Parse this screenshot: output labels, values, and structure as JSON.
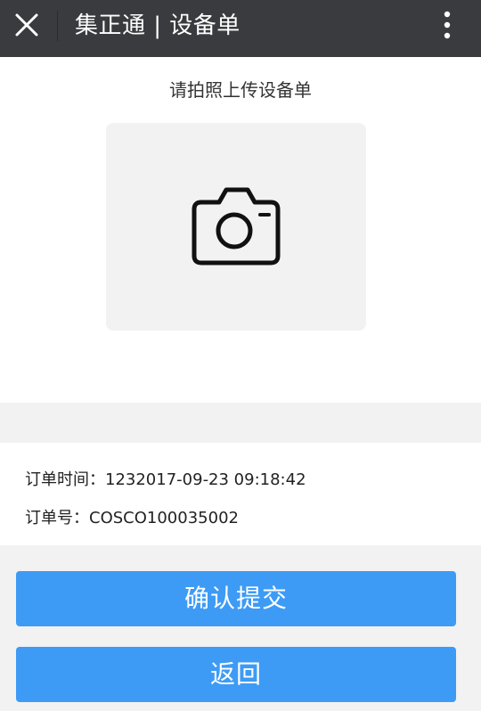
{
  "header": {
    "title": "集正通 | 设备单",
    "close_icon": "close-icon",
    "more_icon": "more-vertical-icon"
  },
  "upload": {
    "prompt": "请拍照上传设备单",
    "icon": "camera-icon"
  },
  "order": {
    "time_label": "订单时间：",
    "time_value": "1232017-09-23 09:18:42",
    "number_label": "订单号：",
    "number_value": "COSCO100035002"
  },
  "buttons": {
    "submit_label": "确认提交",
    "back_label": "返回"
  },
  "colors": {
    "header_bg": "#3a3b3e",
    "button_bg": "#3d9bf5",
    "page_bg": "#f2f2f2"
  }
}
